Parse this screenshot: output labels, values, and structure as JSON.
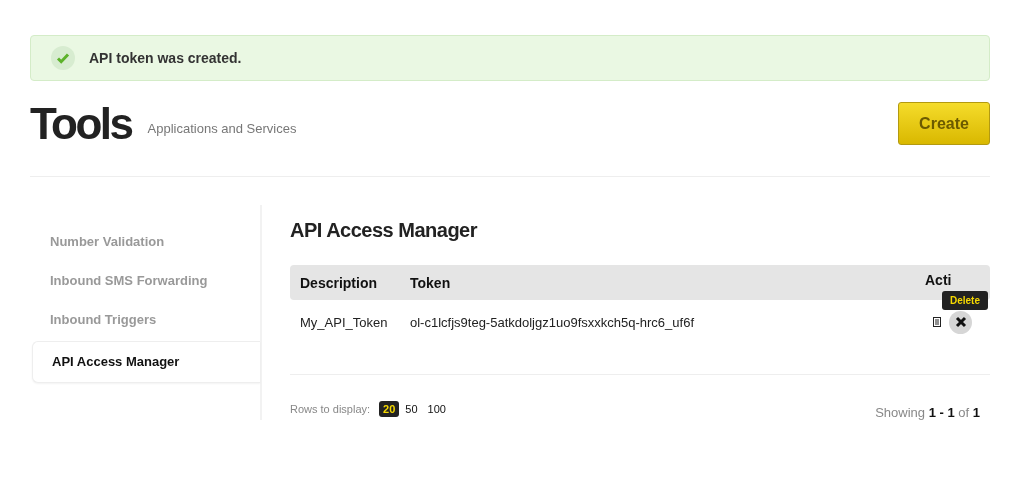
{
  "alert": {
    "message": "API token was created."
  },
  "header": {
    "title": "Tools",
    "subtitle": "Applications and Services",
    "create_button": "Create"
  },
  "sidebar": {
    "items": [
      {
        "label": "Number Validation",
        "selected": false
      },
      {
        "label": "Inbound SMS Forwarding",
        "selected": false
      },
      {
        "label": "Inbound Triggers",
        "selected": false
      },
      {
        "label": "API Access Manager",
        "selected": true
      }
    ]
  },
  "main": {
    "title": "API Access Manager",
    "table": {
      "columns": [
        "Description",
        "Token",
        "Acti"
      ],
      "rows": [
        {
          "description": "My_API_Token",
          "token": "ol-c1lcfjs9teg-5atkdoljgz1uo9fsxxkch5q-hrc6_uf6f"
        }
      ]
    },
    "tooltip": "Delete",
    "pagination": {
      "label": "Rows to display:",
      "options": [
        {
          "label": "20",
          "selected": true
        },
        {
          "label": "50",
          "selected": false
        },
        {
          "label": "100",
          "selected": false
        }
      ],
      "showing": "Showing **1 - 1** of **1**"
    }
  }
}
